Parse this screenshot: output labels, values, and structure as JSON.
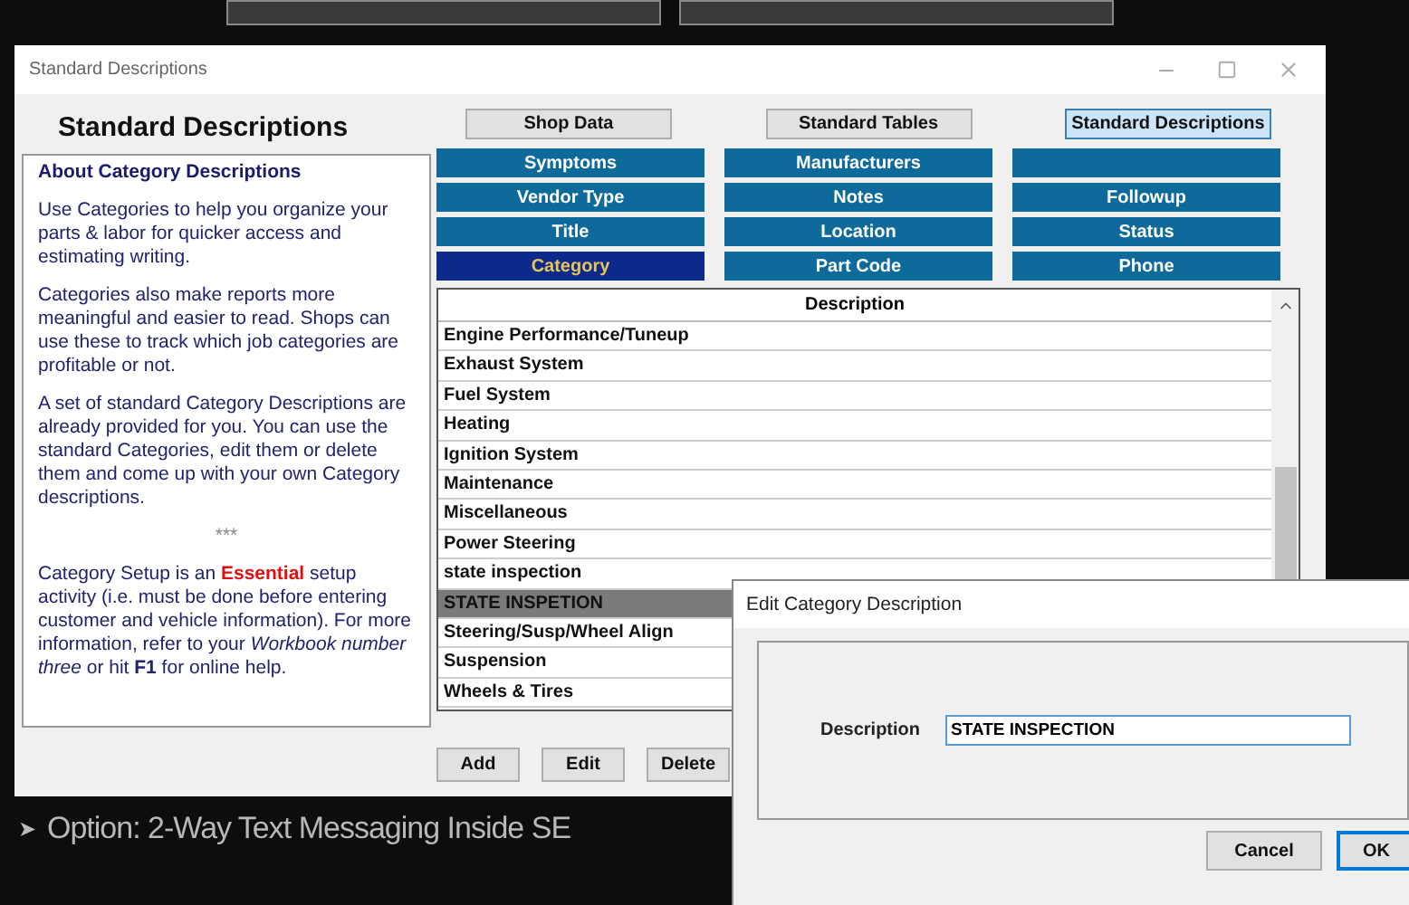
{
  "window": {
    "title": "Standard Descriptions"
  },
  "panel": {
    "heading": "Standard Descriptions",
    "info_title": "About Category Descriptions",
    "paragraphs": [
      [
        {
          "text": "Use Categories to help you organize your parts & labor for quicker access and estimating writing."
        }
      ],
      [
        {
          "text": "Categories also make reports more meaningful and easier to read. Shops can use these to track which job categories are profitable or not."
        }
      ],
      [
        {
          "text": "A set of standard Category Descriptions are already provided for you. You can use the standard Categories, edit them or delete them and come up with your own Category descriptions."
        }
      ],
      [
        {
          "text": "***",
          "kind": "center"
        }
      ],
      [
        {
          "text": "Category Setup is an "
        },
        {
          "text": "Essential",
          "kind": "alert"
        },
        {
          "text": " setup activity (i.e. must be done before entering customer and vehicle information). For more information, refer to your "
        },
        {
          "text": "Workbook number three",
          "kind": "italic"
        },
        {
          "text": " or hit "
        },
        {
          "text": "F1",
          "kind": "key"
        },
        {
          "text": " for online help."
        }
      ]
    ]
  },
  "top_tabs": [
    {
      "label": "Shop Data",
      "selected": false
    },
    {
      "label": "Standard Tables",
      "selected": false
    },
    {
      "label": "Standard Descriptions",
      "selected": true
    }
  ],
  "table_buttons": [
    {
      "label": "Symptoms",
      "selected": false
    },
    {
      "label": "Manufacturers",
      "selected": false
    },
    {
      "selected": false
    },
    {
      "label": "Vendor Type",
      "selected": false
    },
    {
      "label": "Notes",
      "selected": false
    },
    {
      "label": "Followup",
      "selected": false
    },
    {
      "label": "Title",
      "selected": false
    },
    {
      "label": "Location",
      "selected": false
    },
    {
      "label": "Status",
      "selected": false
    },
    {
      "label": "Category",
      "selected": true
    },
    {
      "label": "Part Code",
      "selected": false
    },
    {
      "label": "Phone",
      "selected": false
    }
  ],
  "table": {
    "columns": [
      "Description"
    ],
    "rows": [
      {
        "text": "Engine Performance/Tuneup",
        "selected": false
      },
      {
        "text": "Exhaust System",
        "selected": false
      },
      {
        "text": "Fuel System",
        "selected": false
      },
      {
        "text": "Heating",
        "selected": false
      },
      {
        "text": "Ignition System",
        "selected": false
      },
      {
        "text": "Maintenance",
        "selected": false
      },
      {
        "text": "Miscellaneous",
        "selected": false
      },
      {
        "text": "Power Steering",
        "selected": false
      },
      {
        "text": "state inspection",
        "selected": false
      },
      {
        "text": "STATE INSPETION",
        "selected": true
      },
      {
        "text": "Steering/Susp/Wheel Align",
        "selected": false
      },
      {
        "text": "Suspension",
        "selected": false
      },
      {
        "text": "Wheels & Tires",
        "selected": false
      }
    ]
  },
  "actions": [
    "Add",
    "Edit",
    "Delete"
  ],
  "caption": {
    "marker": "➤",
    "text": "Option: 2-Way Text Messaging Inside SE"
  },
  "dialog": {
    "title": "Edit Category Description",
    "label": "Description",
    "value": "STATE INSPECTION",
    "buttons": [
      {
        "label": "Cancel",
        "default": false
      },
      {
        "label": "OK",
        "default": true
      }
    ]
  }
}
